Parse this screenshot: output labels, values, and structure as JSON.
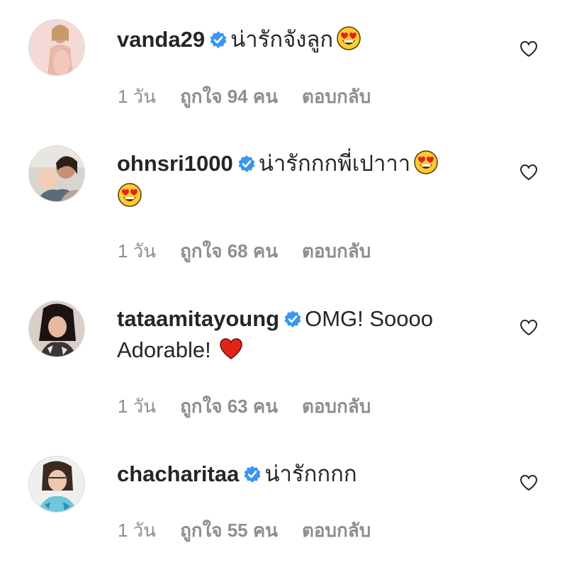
{
  "comments": [
    {
      "username": "vanda29",
      "text": "น่ารักจังลูก",
      "emoji": "heart-eyes",
      "time": "1 วัน",
      "likes": "ถูกใจ 94 คน",
      "reply": "ตอบกลับ"
    },
    {
      "username": "ohnsri1000",
      "text": "น่ารักกกพี่เปาาา",
      "emoji": "heart-eyes",
      "time": "1 วัน",
      "likes": "ถูกใจ 68 คน",
      "reply": "ตอบกลับ"
    },
    {
      "username": "tataamitayoung",
      "text": "OMG! Soooo Adorable!",
      "emoji": "red-heart",
      "time": "1 วัน",
      "likes": "ถูกใจ 63 คน",
      "reply": "ตอบกลับ"
    },
    {
      "username": "chacharitaa",
      "text": "น่ารักกกก",
      "emoji": "",
      "time": "1 วัน",
      "likes": "ถูกใจ 55 คน",
      "reply": "ตอบกลับ"
    }
  ],
  "colors": {
    "verified": "#3897f0",
    "meta": "#8e8e8e",
    "text": "#262626",
    "heart_red": "#e0241a",
    "emoji_yellow": "#ffcc33"
  }
}
